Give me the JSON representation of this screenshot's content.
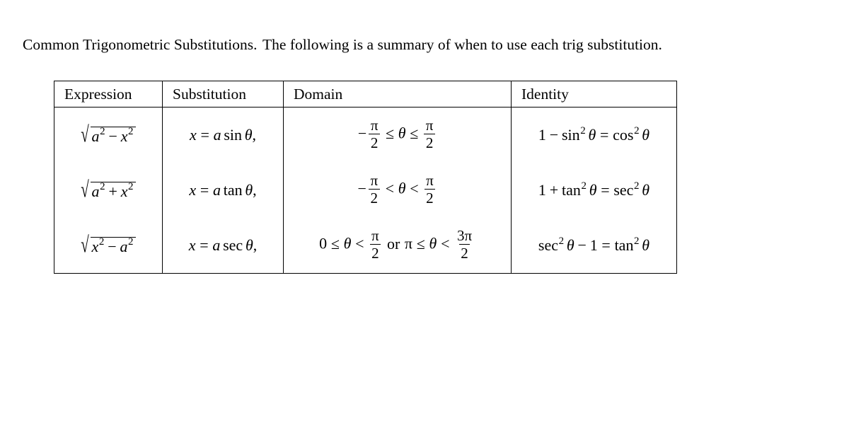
{
  "document": {
    "intro": {
      "title": "Common Trigonometric Substitutions.",
      "body": "The following is a summary of when to use each trig substitution."
    }
  },
  "table": {
    "headers": [
      {
        "key": "expression",
        "label": "Expression"
      },
      {
        "key": "substitution",
        "label": "Substitution"
      },
      {
        "key": "domain",
        "label": "Domain"
      },
      {
        "key": "identity",
        "label": "Identity"
      }
    ],
    "rows": [
      {
        "expression": {
          "text": "sqrt(a^2 - x^2)",
          "radicand_left_var": "a",
          "radicand_operator": "−",
          "radicand_right_var": "x",
          "exponent": "2"
        },
        "substitution": {
          "text": "x = a sin θ,",
          "variable": "x",
          "relation": "=",
          "coefficient": "a",
          "function": "sin",
          "angle": "θ",
          "trailing": ","
        },
        "domain": {
          "text": "-π/2 ≤ θ ≤ π/2",
          "lower_sign": "−",
          "lower_num": "π",
          "lower_den": "2",
          "rel_left": "≤",
          "angle": "θ",
          "rel_right": "≤",
          "upper_num": "π",
          "upper_den": "2"
        },
        "identity": {
          "text": "1 - sin^2 θ = cos^2 θ",
          "lhs_number": "1",
          "operator": "−",
          "lhs_function": "sin",
          "lhs_exponent": "2",
          "angle": "θ",
          "relation": "=",
          "rhs_function": "cos",
          "rhs_exponent": "2"
        }
      },
      {
        "expression": {
          "text": "sqrt(a^2 + x^2)",
          "radicand_left_var": "a",
          "radicand_operator": "+",
          "radicand_right_var": "x",
          "exponent": "2"
        },
        "substitution": {
          "text": "x = a tan θ,",
          "variable": "x",
          "relation": "=",
          "coefficient": "a",
          "function": "tan",
          "angle": "θ",
          "trailing": ","
        },
        "domain": {
          "text": "-π/2 < θ < π/2",
          "lower_sign": "−",
          "lower_num": "π",
          "lower_den": "2",
          "rel_left": "<",
          "angle": "θ",
          "rel_right": "<",
          "upper_num": "π",
          "upper_den": "2"
        },
        "identity": {
          "text": "1 + tan^2 θ = sec^2 θ",
          "lhs_number": "1",
          "operator": "+",
          "lhs_function": "tan",
          "lhs_exponent": "2",
          "angle": "θ",
          "relation": "=",
          "rhs_function": "sec",
          "rhs_exponent": "2"
        }
      },
      {
        "expression": {
          "text": "sqrt(x^2 - a^2)",
          "radicand_left_var": "x",
          "radicand_operator": "−",
          "radicand_right_var": "a",
          "exponent": "2"
        },
        "substitution": {
          "text": "x = a sec θ,",
          "variable": "x",
          "relation": "=",
          "coefficient": "a",
          "function": "sec",
          "angle": "θ",
          "trailing": ","
        },
        "domain": {
          "text": "0 ≤ θ < π/2 or π ≤ θ < 3π/2",
          "first_lower": "0",
          "first_rel_left": "≤",
          "angle": "θ",
          "first_rel_right": "<",
          "first_upper_num": "π",
          "first_upper_den": "2",
          "conjunction": "or",
          "second_lower": "π",
          "second_rel_left": "≤",
          "second_rel_right": "<",
          "second_upper_num": "3π",
          "second_upper_den": "2"
        },
        "identity": {
          "text": "sec^2 θ - 1 = tan^2 θ",
          "lhs_function": "sec",
          "lhs_exponent": "2",
          "angle": "θ",
          "operator": "−",
          "lhs_number": "1",
          "relation": "=",
          "rhs_function": "tan",
          "rhs_exponent": "2"
        }
      }
    ]
  }
}
